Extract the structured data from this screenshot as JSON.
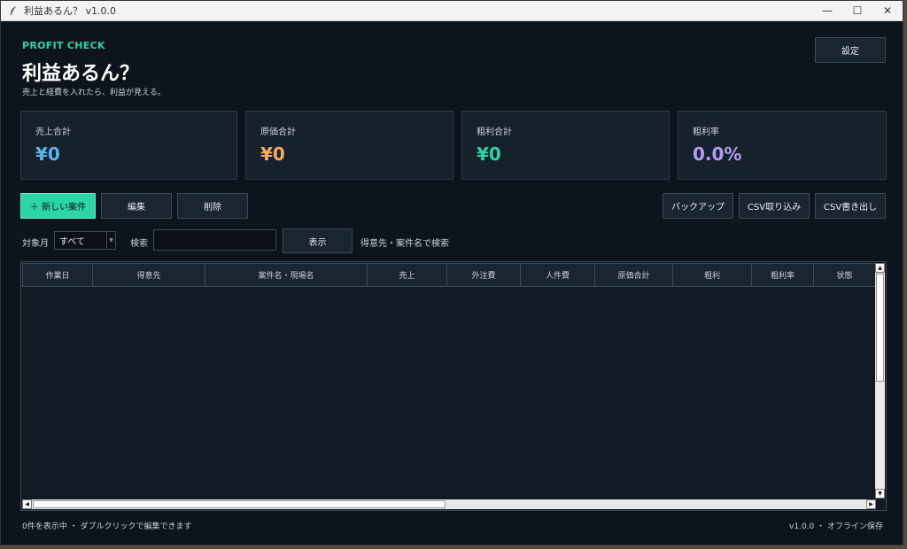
{
  "window": {
    "title": "利益あるん？  v1.0.0",
    "minimize_glyph": "—",
    "maximize_glyph": "☐",
    "close_glyph": "✕"
  },
  "header": {
    "eyebrow": "PROFIT CHECK",
    "title": "利益あるん？",
    "subtitle": "売上と経費を入れたら、利益が見える。",
    "settings_label": "設定"
  },
  "summary": [
    {
      "label": "売上合計",
      "value": "¥0",
      "color": "#5ab4f0"
    },
    {
      "label": "原価合計",
      "value": "¥0",
      "color": "#f5a860"
    },
    {
      "label": "粗利合計",
      "value": "¥0",
      "color": "#2dd4a6"
    },
    {
      "label": "粗利率",
      "value": "0.0%",
      "color": "#b49cf5"
    }
  ],
  "toolbar": {
    "new_label": "＋ 新しい案件",
    "edit_label": "編集",
    "delete_label": "削除",
    "backup_label": "バックアップ",
    "import_label": "CSV取り込み",
    "export_label": "CSV書き出し"
  },
  "filter": {
    "month_label": "対象月",
    "month_value": "すべて",
    "search_label": "検索",
    "search_value": "",
    "show_label": "表示",
    "hint": "得意先・案件名で検索"
  },
  "table": {
    "columns": [
      "作業日",
      "得意先",
      "案件名・現場名",
      "売上",
      "外注費",
      "人件費",
      "原価合計",
      "粗利",
      "粗利率",
      "状態"
    ],
    "rows": []
  },
  "footer": {
    "status": "0件を表示中 ・ ダブルクリックで編集できます",
    "version": "v1.0.0 ・ オフライン保存"
  },
  "colors": {
    "accent": "#2dd4a6",
    "background": "#0e141b",
    "card": "#17212b"
  }
}
